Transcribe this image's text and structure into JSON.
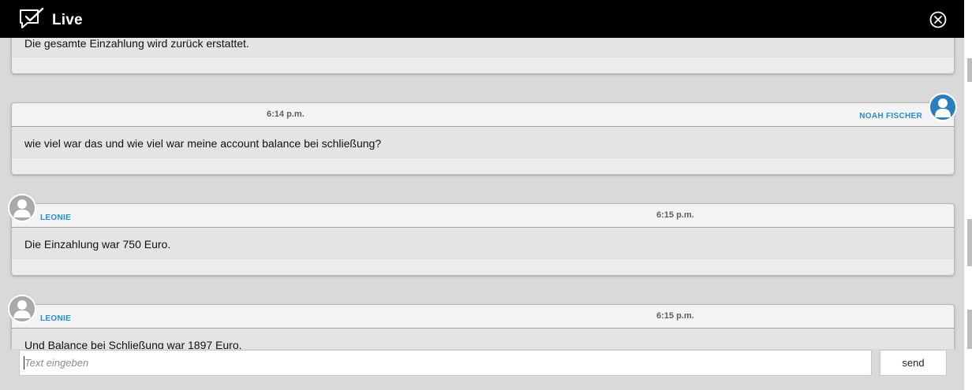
{
  "header": {
    "title": "Live",
    "logo_icon": "chat-check-icon",
    "close_icon": "circle-close-icon"
  },
  "messages": [
    {
      "body": "Die gesamte Einzahlung wird zurück erstattet.",
      "side": "agent"
    },
    {
      "time": "6:14 p.m.",
      "author": "NOAH FISCHER",
      "body": "wie viel war das und wie viel war meine account balance bei schließung?",
      "side": "user",
      "avatar_icon": "user-avatar-icon"
    },
    {
      "time": "6:15 p.m.",
      "author": "LEONIE",
      "body": "Die Einzahlung war 750 Euro.",
      "side": "agent",
      "avatar_icon": "agent-avatar-icon"
    },
    {
      "time": "6:15 p.m.",
      "author": "LEONIE",
      "body": "Und Balance bei Schließung war 1897 Euro.",
      "side": "agent",
      "avatar_icon": "agent-avatar-icon"
    }
  ],
  "composer": {
    "placeholder": "Text eingeben",
    "value": "",
    "send_label": "send"
  },
  "colors": {
    "header_bg": "#000000",
    "chat_bg": "#d9d9d9",
    "author_blue": "#2b8cc9",
    "user_avatar_blue": "#2b7fc0",
    "agent_avatar_gray": "#a9a9a9"
  }
}
